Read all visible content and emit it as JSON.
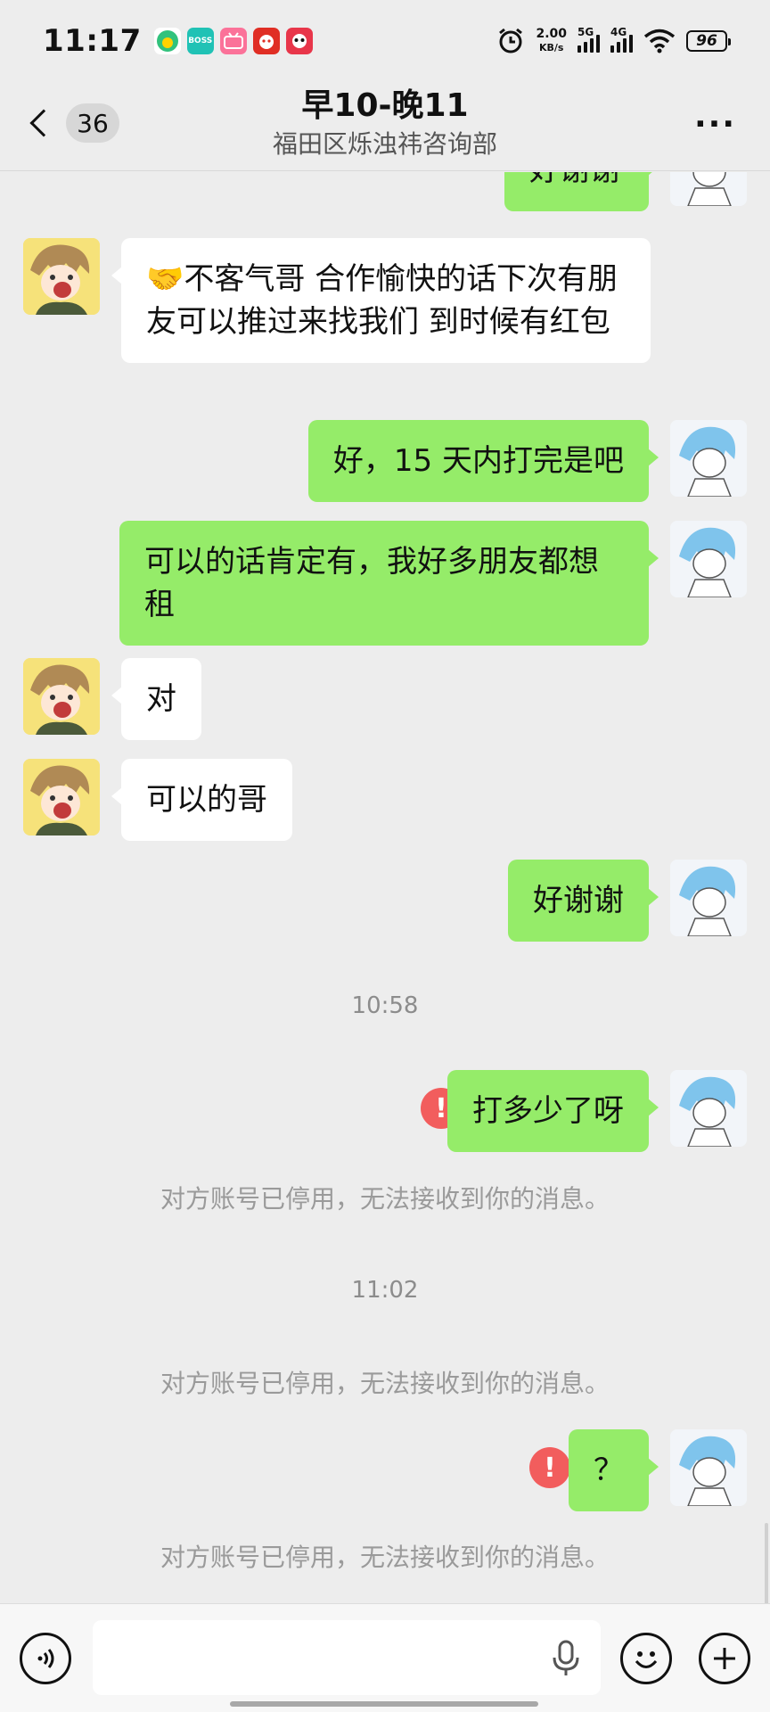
{
  "status_bar": {
    "time": "11:17",
    "net_speed_value": "2.00",
    "net_speed_unit": "KB/s",
    "signal_1": "5G",
    "signal_2": "4G",
    "battery": "96",
    "app_icons": [
      "qq-music-icon",
      "boss-zhipin-icon",
      "bilibili-icon",
      "pinduoduo-icon",
      "panda-app-icon"
    ]
  },
  "header": {
    "unread_count": "36",
    "title": "早10-晚11",
    "subtitle": "福田区烁浊祎咨询部",
    "more": "···"
  },
  "messages": [
    {
      "side": "right",
      "text": "好谢谢"
    },
    {
      "side": "left",
      "text": "🤝不客气哥 合作愉快的话下次有朋友可以推过来找我们 到时候有红包"
    },
    {
      "side": "right",
      "text": "好，15 天内打完是吧"
    },
    {
      "side": "right",
      "text": "可以的话肯定有，我好多朋友都想租"
    },
    {
      "side": "left",
      "text": "对"
    },
    {
      "side": "left",
      "text": "可以的哥"
    },
    {
      "side": "right",
      "text": "好谢谢"
    },
    {
      "side": "right",
      "text": "打多少了呀",
      "failed": true
    },
    {
      "side": "right",
      "text": "？",
      "failed": true
    }
  ],
  "timestamps": [
    "10:58",
    "11:02"
  ],
  "system_notice": "对方账号已停用，无法接收到你的消息。",
  "input_bar": {
    "voice_icon": "voice-toggle-icon",
    "mic_icon": "microphone-icon",
    "emoji_icon": "emoji-icon",
    "plus_icon": "plus-icon"
  },
  "colors": {
    "background": "#ededed",
    "my_bubble": "#95ec69",
    "their_bubble": "#ffffff",
    "error": "#f25d5d"
  }
}
